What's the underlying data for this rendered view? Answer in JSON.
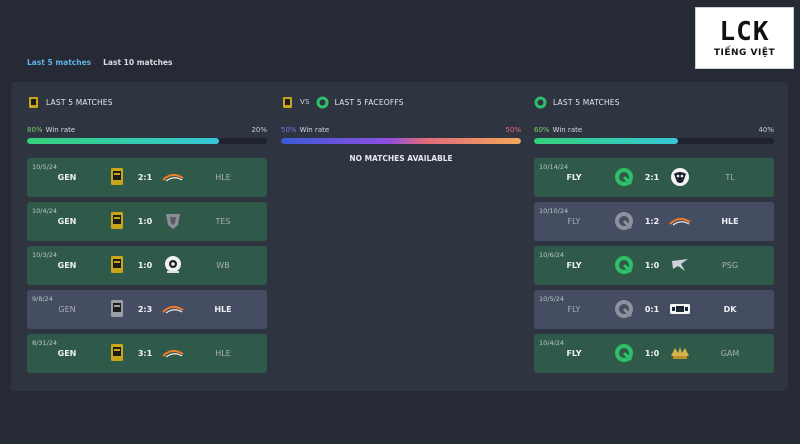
{
  "brand": {
    "name": "LCK",
    "subtitle": "TIẾNG VIỆT"
  },
  "tabs": [
    {
      "label": "Last 5 matches",
      "active": true
    },
    {
      "label": "Last 10 matches",
      "active": false
    }
  ],
  "colors": {
    "win": "#2f5a4a",
    "loss": "#454d63",
    "accent": "#5fb3e6",
    "win_rate": "#7bd36a",
    "fly_green": "#2fbf6a",
    "gen_gold": "#c9a51c"
  },
  "left": {
    "title": "LAST 5 MATCHES",
    "team_icon": "gen-logo",
    "win_pct": "80%",
    "win_label": "Win rate",
    "loss_pct": "20%",
    "win_rate": 0.8,
    "matches": [
      {
        "date": "10/5/24",
        "team": "GEN",
        "score": "2:1",
        "opp": "HLE",
        "result": "win",
        "opp_icon": "hle-logo",
        "team_dim": false
      },
      {
        "date": "10/4/24",
        "team": "GEN",
        "score": "1:0",
        "opp": "TES",
        "result": "win",
        "opp_icon": "tes-logo",
        "team_dim": false
      },
      {
        "date": "10/3/24",
        "team": "GEN",
        "score": "1:0",
        "opp": "WB",
        "result": "win",
        "opp_icon": "wb-logo",
        "team_dim": false
      },
      {
        "date": "9/8/24",
        "team": "GEN",
        "score": "2:3",
        "opp": "HLE",
        "result": "loss",
        "opp_icon": "hle-logo",
        "team_dim": true
      },
      {
        "date": "8/31/24",
        "team": "GEN",
        "score": "3:1",
        "opp": "HLE",
        "result": "win",
        "opp_icon": "hle-logo",
        "team_dim": false
      }
    ]
  },
  "middle": {
    "vs": "VS",
    "title": "LAST 5 FACEOFFS",
    "left_pct": "50%",
    "win_label": "Win rate",
    "right_pct": "50%",
    "split": 0.5,
    "empty_text": "NO MATCHES AVAILABLE"
  },
  "right": {
    "title": "LAST 5 MATCHES",
    "team_icon": "fly-logo",
    "win_pct": "60%",
    "win_label": "Win rate",
    "loss_pct": "40%",
    "win_rate": 0.6,
    "matches": [
      {
        "date": "10/14/24",
        "team": "FLY",
        "score": "2:1",
        "opp": "TL",
        "result": "win",
        "opp_icon": "tl-logo",
        "team_dim": false
      },
      {
        "date": "10/10/24",
        "team": "FLY",
        "score": "1:2",
        "opp": "HLE",
        "result": "loss",
        "opp_icon": "hle-logo",
        "team_dim": true
      },
      {
        "date": "10/6/24",
        "team": "FLY",
        "score": "1:0",
        "opp": "PSG",
        "result": "win",
        "opp_icon": "psg-logo",
        "team_dim": false
      },
      {
        "date": "10/5/24",
        "team": "FLY",
        "score": "0:1",
        "opp": "DK",
        "result": "loss",
        "opp_icon": "dk-logo",
        "team_dim": true
      },
      {
        "date": "10/4/24",
        "team": "FLY",
        "score": "1:0",
        "opp": "GAM",
        "result": "win",
        "opp_icon": "gam-logo",
        "team_dim": false
      }
    ]
  }
}
